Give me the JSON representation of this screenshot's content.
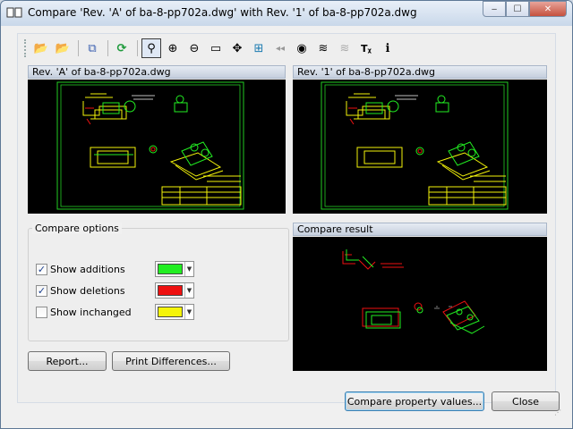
{
  "window": {
    "title": "Compare 'Rev. 'A' of ba-8-pp702a.dwg' with Rev. '1' of ba-8-pp702a.dwg",
    "minimize_glyph": "‒",
    "maximize_glyph": "☐",
    "close_glyph": "✕"
  },
  "toolbar": {
    "items": [
      {
        "icon": "open-folder-a-icon",
        "glyph": "📂"
      },
      {
        "icon": "open-folder-b-icon",
        "glyph": "📂"
      },
      {
        "icon": "copy-compare-icon",
        "glyph": "⧉"
      },
      {
        "icon": "refresh-icon",
        "glyph": "⟳"
      },
      {
        "icon": "zoom-realtime-icon",
        "glyph": "⚲"
      },
      {
        "icon": "zoom-in-icon",
        "glyph": "⊕"
      },
      {
        "icon": "zoom-out-icon",
        "glyph": "⊖"
      },
      {
        "icon": "zoom-window-icon",
        "glyph": "▭"
      },
      {
        "icon": "pan-icon",
        "glyph": "✥"
      },
      {
        "icon": "layers-tree-icon",
        "glyph": "⊞"
      },
      {
        "icon": "previous-view-icon",
        "glyph": "◂◂"
      },
      {
        "icon": "view-eye-icon",
        "glyph": "◉"
      },
      {
        "icon": "layers-icon",
        "glyph": "≋"
      },
      {
        "icon": "layers-disabled-icon",
        "glyph": "≋"
      },
      {
        "icon": "text-style-icon",
        "glyph": "Tᵪ"
      },
      {
        "icon": "info-icon",
        "glyph": "ℹ"
      }
    ]
  },
  "left_pane": {
    "header": "Rev. 'A' of ba-8-pp702a.dwg"
  },
  "right_pane": {
    "header": "Rev. '1' of ba-8-pp702a.dwg"
  },
  "result_pane": {
    "header": "Compare result"
  },
  "options": {
    "title": "Compare options",
    "rows": [
      {
        "label": "Show additions",
        "checked": true,
        "check_glyph": "✓",
        "color": "#22ee22"
      },
      {
        "label": "Show deletions",
        "checked": true,
        "check_glyph": "✓",
        "color": "#ee1111"
      },
      {
        "label": "Show inchanged",
        "checked": false,
        "check_glyph": "",
        "color": "#f4f40a"
      }
    ],
    "dropdown_glyph": "▼"
  },
  "buttons": {
    "report": "Report...",
    "print": "Print Differences...",
    "compare_props": "Compare property values...",
    "close": "Close"
  },
  "colors": {
    "drawing_bg": "#000000",
    "additions": "#22ee22",
    "deletions": "#ee1111",
    "unchanged": "#f4f40a",
    "frame_green": "#22cc22"
  }
}
